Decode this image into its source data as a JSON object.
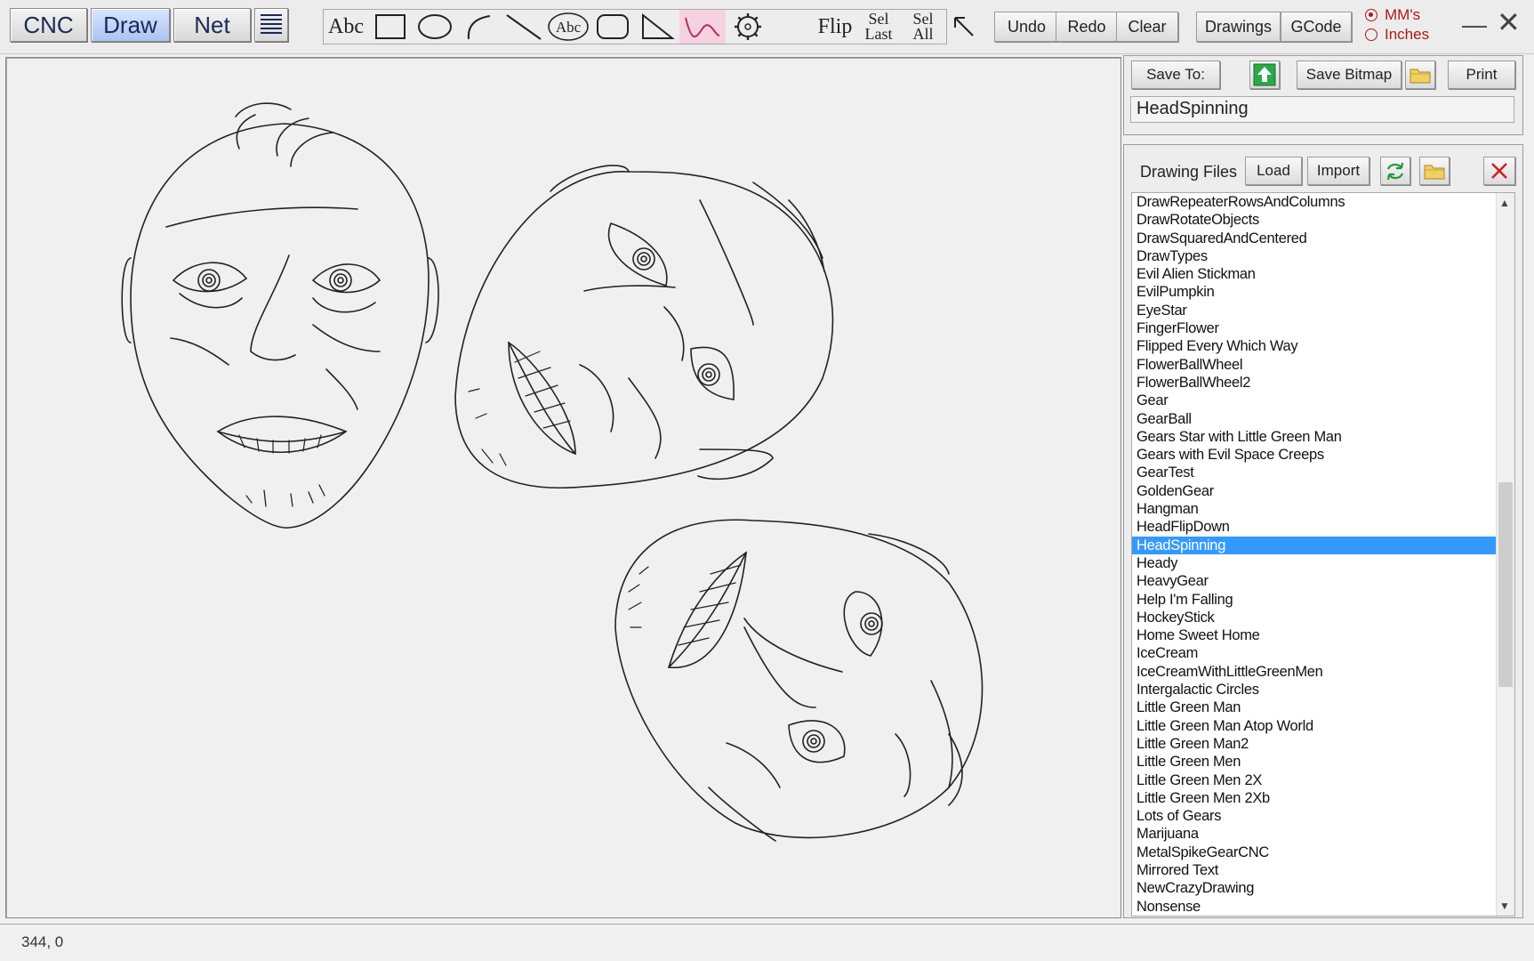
{
  "modes": {
    "cnc": "CNC",
    "draw": "Draw",
    "net": "Net"
  },
  "tools": {
    "text": "Abc",
    "text_oval": "Abc",
    "flip": "Flip",
    "sel_last_1": "Sel",
    "sel_last_2": "Last",
    "sel_all_1": "Sel",
    "sel_all_2": "All"
  },
  "commands": {
    "undo": "Undo",
    "redo": "Redo",
    "clear": "Clear",
    "drawings": "Drawings",
    "gcode": "GCode"
  },
  "units": {
    "mm": "MM's",
    "inches": "Inches",
    "selected": "MM's"
  },
  "save": {
    "save_to": "Save To:",
    "save_bitmap": "Save Bitmap",
    "print": "Print",
    "filename": "HeadSpinning"
  },
  "files": {
    "label": "Drawing Files",
    "load": "Load",
    "import": "Import",
    "selected": "HeadSpinning",
    "items": [
      "DrawRepeaterRowsAndColumns",
      "DrawRotateObjects",
      "DrawSquaredAndCentered",
      "DrawTypes",
      "Evil Alien Stickman",
      "EvilPumpkin",
      "EyeStar",
      "FingerFlower",
      "Flipped Every Which Way",
      "FlowerBallWheel",
      "FlowerBallWheel2",
      "Gear",
      "GearBall",
      "Gears Star with Little Green Man",
      "Gears with Evil Space Creeps",
      "GearTest",
      "GoldenGear",
      "Hangman",
      "HeadFlipDown",
      "HeadSpinning",
      "Heady",
      "HeavyGear",
      "Help I'm Falling",
      "HockeyStick",
      "Home Sweet Home",
      "IceCream",
      "IceCreamWithLittleGreenMen",
      "Intergalactic Circles",
      "Little Green Man",
      "Little Green Man Atop World",
      "Little Green Man2",
      "Little Green Men",
      "Little Green Men 2X",
      "Little Green Men 2Xb",
      "Lots of Gears",
      "Marijuana",
      "MetalSpikeGearCNC",
      "Mirrored Text",
      "NewCrazyDrawing",
      "Nonsense"
    ]
  },
  "status": {
    "coords": "344, 0"
  }
}
